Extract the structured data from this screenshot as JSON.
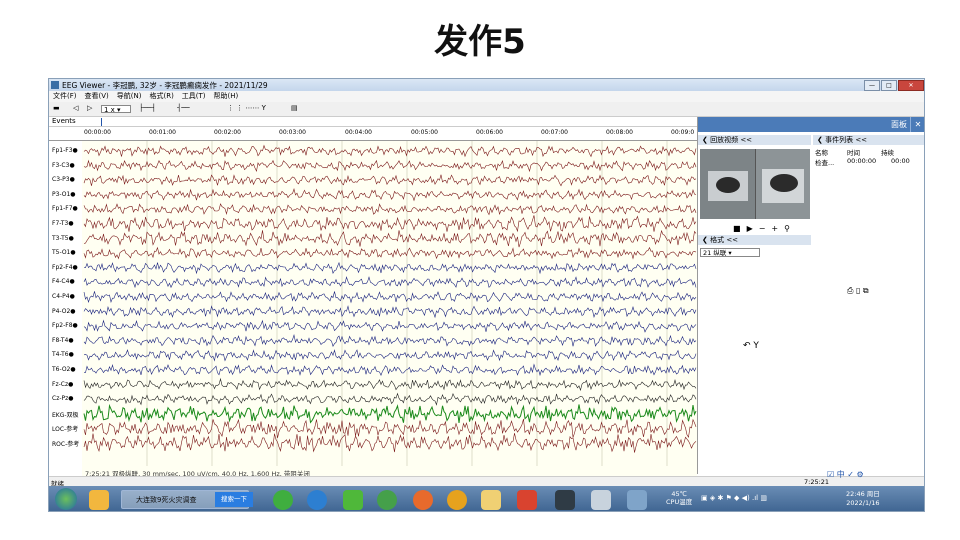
{
  "slide": {
    "title": "发作5"
  },
  "window": {
    "title": "EEG Viewer - 李冠鹏, 32岁 - 李冠鹏癫痫发作 - 2021/11/29",
    "menus": [
      "文件(F)",
      "查看(V)",
      "导航(N)",
      "格式(R)",
      "工具(T)",
      "帮助(H)"
    ],
    "speed_select": "1 x",
    "events_label": "Events",
    "timestamps": [
      "00:00:00",
      "00:01:00",
      "00:02:00",
      "00:03:00",
      "00:04:00",
      "00:05:00",
      "00:06:00",
      "00:07:00",
      "00:08:00",
      "00:09:0"
    ],
    "channels": [
      {
        "label": "Fp1-F3●",
        "color": "#7b1a1a"
      },
      {
        "label": "F3-C3●",
        "color": "#7b1a1a"
      },
      {
        "label": "C3-P3●",
        "color": "#7b1a1a"
      },
      {
        "label": "P3-O1●",
        "color": "#7b1a1a"
      },
      {
        "label": "Fp1-F7●",
        "color": "#7b1a1a"
      },
      {
        "label": "F7-T3●",
        "color": "#7b1a1a"
      },
      {
        "label": "T3-T5●",
        "color": "#7b1a1a"
      },
      {
        "label": "T5-O1●",
        "color": "#7b1a1a"
      },
      {
        "label": "Fp2-F4●",
        "color": "#1a237e"
      },
      {
        "label": "F4-C4●",
        "color": "#1a237e"
      },
      {
        "label": "C4-P4●",
        "color": "#1a237e"
      },
      {
        "label": "P4-O2●",
        "color": "#1a237e"
      },
      {
        "label": "Fp2-F8●",
        "color": "#1a237e"
      },
      {
        "label": "F8-T4●",
        "color": "#1a237e"
      },
      {
        "label": "T4-T6●",
        "color": "#1a237e"
      },
      {
        "label": "T6-O2●",
        "color": "#1a237e"
      },
      {
        "label": "Fz-Cz●",
        "color": "#222222"
      },
      {
        "label": "Cz-Pz●",
        "color": "#222222"
      },
      {
        "label": "EKG-双极",
        "color": "#1b8a1b"
      },
      {
        "label": "LOC-参考",
        "color": "#7b1a1a"
      },
      {
        "label": "ROC-参考",
        "color": "#7b1a1a"
      }
    ],
    "eeg_status": "7:25:21 双极纵联, 30 mm/sec, 100 uV/cm, 40.0 Hz, 1.600 Hz, 带阻关闭",
    "panel": {
      "title": "面板",
      "video_header": "回放视频 <<",
      "events_header": "事件列表 <<",
      "event_columns": [
        "名称",
        "时间",
        "持续"
      ],
      "event_rows": [
        [
          "检查...",
          "00:00:00",
          "00:00"
        ]
      ],
      "format_header": "格式 <<",
      "montage_value": "21  纵联"
    },
    "status_left": "就绪",
    "status_right": "7:25:21",
    "lang_indicator": "中"
  },
  "taskbar": {
    "task_label": "大连致9死火灾调查",
    "search_label": "搜索一下",
    "cpu_temp": "45℃",
    "cpu_label": "CPU温度",
    "time": "22:46 周日",
    "date": "2022/1/16"
  }
}
